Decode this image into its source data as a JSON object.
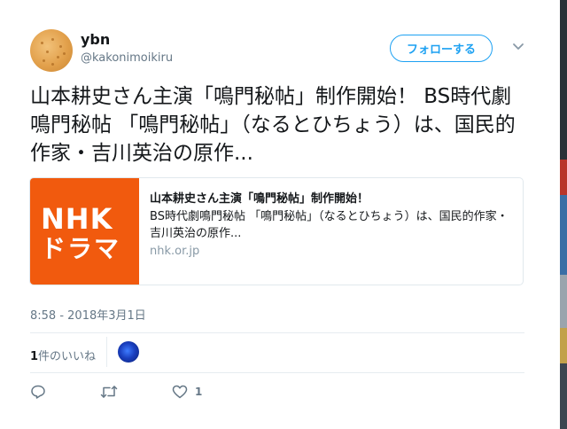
{
  "user": {
    "display_name": "ybn",
    "screen_name": "@kakonimoikiru",
    "avatar_icon": "cookie-avatar-icon"
  },
  "follow_button": {
    "label": "フォローする"
  },
  "tweet": {
    "text": "山本耕史さん主演「鳴門秘帖」制作開始！ BS時代劇鳴門秘帖 「鳴門秘帖」（なるとひちょう）は、国民的作家・吉川英治の原作..."
  },
  "link_card": {
    "thumb_logo": "NHK",
    "thumb_sub": "ドラマ",
    "thumb_color": "#f15a0e",
    "title": "山本耕史さん主演「鳴門秘帖」制作開始！",
    "description": "BS時代劇鳴門秘帖 「鳴門秘帖」（なるとひちょう）は、国民的作家・吉川英治の原作...",
    "domain": "nhk.or.jp"
  },
  "timestamp": "8:58 - 2018年3月1日",
  "likes": {
    "count": "1",
    "label": "件のいいね"
  },
  "actions": {
    "reply_icon": "reply-icon",
    "retweet_icon": "retweet-icon",
    "like_icon": "heart-icon",
    "like_count": "1"
  },
  "colors": {
    "accent": "#1da1f2",
    "secondary_text": "#657786",
    "divider": "#e6ecf0"
  }
}
